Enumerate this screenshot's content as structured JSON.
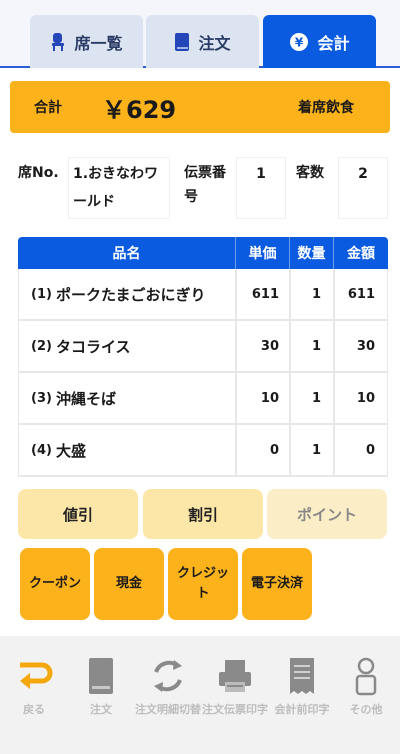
{
  "tabs": [
    {
      "label": "席一覧",
      "icon": "chair-icon"
    },
    {
      "label": "注文",
      "icon": "book-icon"
    },
    {
      "label": "会計",
      "icon": "yen-coin-icon"
    }
  ],
  "total": {
    "label": "合計",
    "amount": "￥629",
    "seating": "着席飲食"
  },
  "info": {
    "seat_label": "席No.",
    "seat_value": "1.おきなわワールド",
    "slip_label": "伝票番号",
    "slip_value": "1",
    "guests_label": "客数",
    "guests_value": "2"
  },
  "table": {
    "headers": [
      "品名",
      "単価",
      "数量",
      "金額"
    ],
    "rows": [
      {
        "index": "(1)",
        "name": "ポークたまごおにぎり",
        "price": "611",
        "qty": "1",
        "amount": "611"
      },
      {
        "index": "(2)",
        "name": "タコライス",
        "price": "30",
        "qty": "1",
        "amount": "30"
      },
      {
        "index": "(3)",
        "name": "沖縄そば",
        "price": "10",
        "qty": "1",
        "amount": "10"
      },
      {
        "index": "(4)",
        "name": "大盛",
        "price": "0",
        "qty": "1",
        "amount": "0"
      }
    ]
  },
  "discounts": {
    "nebiki": "値引",
    "waribiki": "割引",
    "point": "ポイント"
  },
  "payments": {
    "coupon": "クーポン",
    "cash": "現金",
    "credit": "クレジット",
    "electronic": "電子決済"
  },
  "bottom_nav": [
    {
      "label": "戻る",
      "icon": "return-arrow-icon"
    },
    {
      "label": "注文",
      "icon": "document-icon"
    },
    {
      "label": "注文明細切替",
      "icon": "refresh-icon"
    },
    {
      "label": "注文伝票印字",
      "icon": "printer-icon"
    },
    {
      "label": "会計前印字",
      "icon": "receipt-icon"
    },
    {
      "label": "その他",
      "icon": "person-icon"
    }
  ],
  "colors": {
    "accent_blue": "#0a5be0",
    "accent_orange": "#fbb21b",
    "light_orange": "#fde7a8"
  }
}
